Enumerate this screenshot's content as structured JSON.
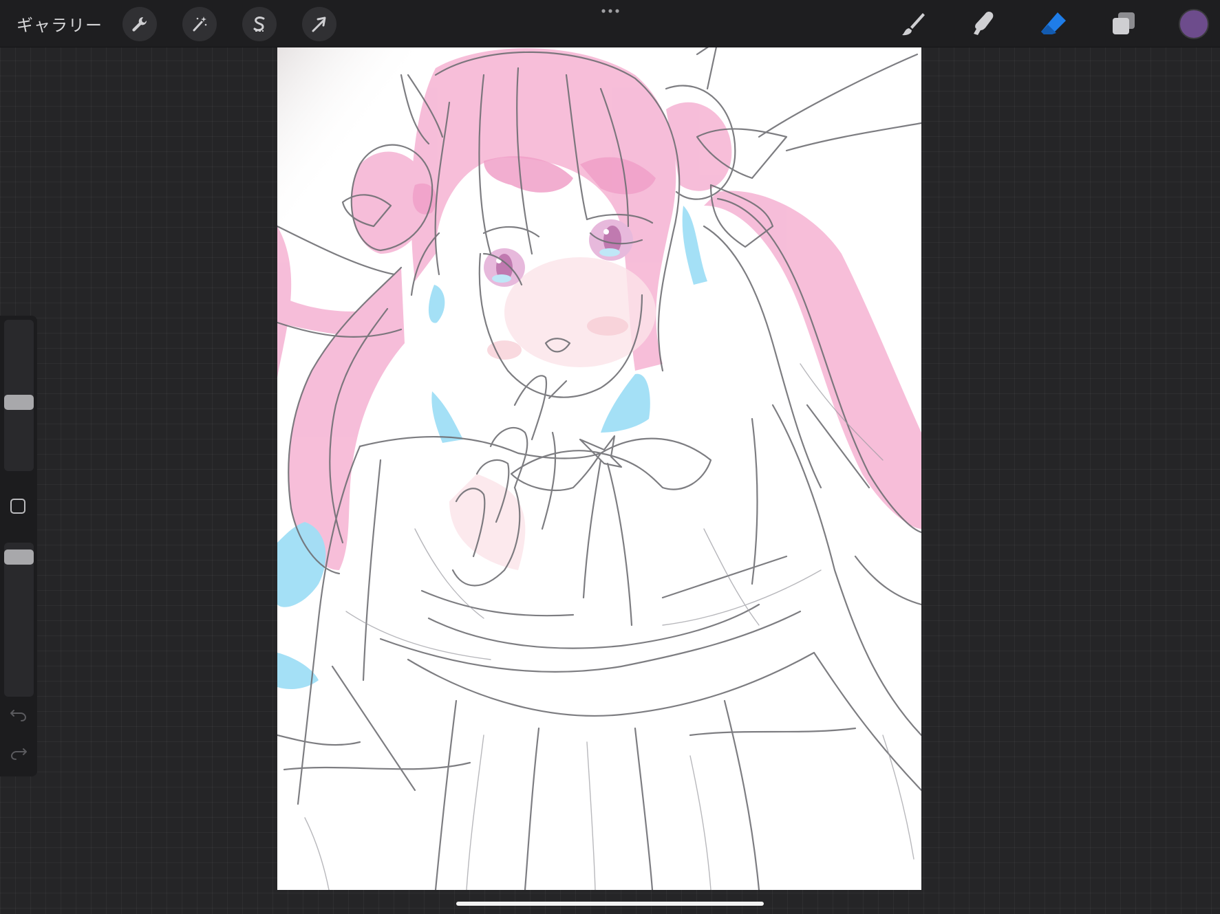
{
  "topbar": {
    "gallery_label": "ギャラリー",
    "left_tools": [
      {
        "name": "actions",
        "icon": "wrench-icon"
      },
      {
        "name": "adjustments",
        "icon": "magic-wand-icon"
      },
      {
        "name": "selection",
        "icon": "selection-s-icon"
      },
      {
        "name": "transform",
        "icon": "arrow-cursor-icon"
      }
    ],
    "more_icon": "more-dots-icon",
    "right_tools": [
      {
        "name": "brush",
        "icon": "brush-icon",
        "active": false
      },
      {
        "name": "smudge",
        "icon": "smudge-finger-icon",
        "active": false
      },
      {
        "name": "eraser",
        "icon": "eraser-icon",
        "active": true
      },
      {
        "name": "layers",
        "icon": "layers-icon",
        "active": false
      }
    ],
    "current_color": "#6d4c8c",
    "active_color": "#1f7de8"
  },
  "sidebar": {
    "brush_size_level": 0.45,
    "opacity_level": 0.95,
    "modify_icon": "square-icon",
    "undo_icon": "undo-icon",
    "redo_icon": "redo-icon"
  },
  "canvas": {
    "hair_color": "#f6b8d6",
    "hair_accent": "#f0a0c8",
    "highlight_color": "#9fdef6",
    "sketch_color": "#6f6f74",
    "eye_color": "#c07ab0"
  }
}
